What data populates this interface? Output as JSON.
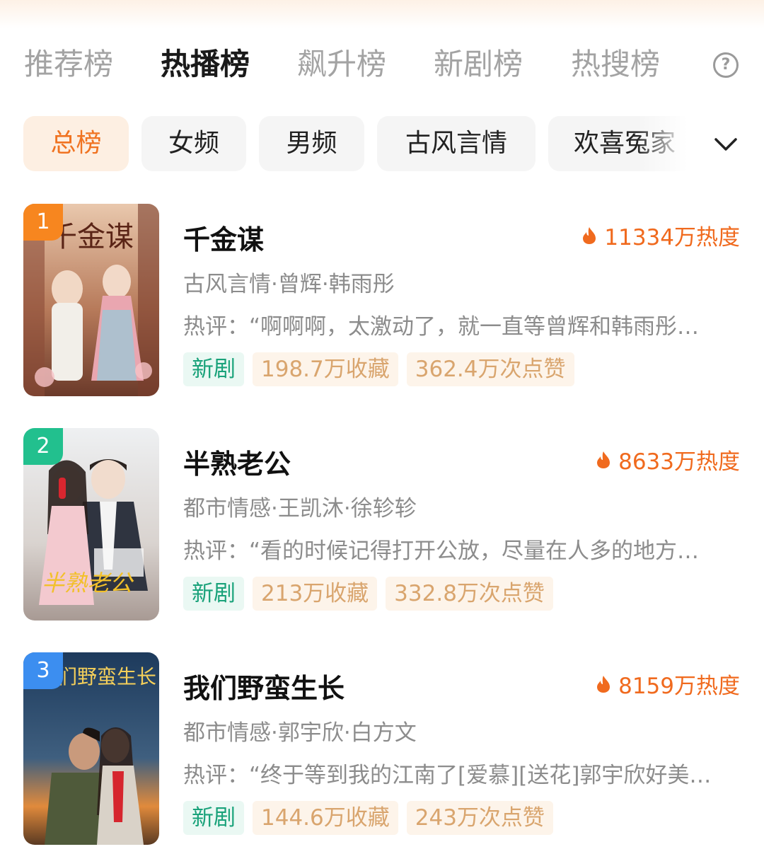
{
  "tabs": [
    {
      "label": "推荐榜",
      "active": false
    },
    {
      "label": "热播榜",
      "active": true
    },
    {
      "label": "飙升榜",
      "active": false
    },
    {
      "label": "新剧榜",
      "active": false
    },
    {
      "label": "热搜榜",
      "active": false
    }
  ],
  "help_icon": {
    "glyph": "?",
    "icon": "question-circle-icon"
  },
  "filters": [
    {
      "label": "总榜",
      "active": true
    },
    {
      "label": "女频",
      "active": false
    },
    {
      "label": "男频",
      "active": false
    },
    {
      "label": "古风言情",
      "active": false
    },
    {
      "label": "欢喜冤家",
      "active": false
    }
  ],
  "expand_icon": "chevron-down-icon",
  "colors": {
    "accent": "#f06a1e",
    "rank_1": "#f7861f",
    "rank_2": "#22c08e",
    "rank_3": "#3c8ef0",
    "tag_new_text": "#19a27a",
    "tag_stat_text": "#d9a56e"
  },
  "items": [
    {
      "rank": "1",
      "title": "千金谋",
      "heat": "11334万热度",
      "meta": "古风言情·曾辉·韩雨彤",
      "comment": "热评：“啊啊啊，太激动了，就一直等曾辉和韩雨彤…",
      "tags": {
        "new": "新剧",
        "collect": "198.7万收藏",
        "likes": "362.4万次点赞"
      },
      "poster_text": "千金谋"
    },
    {
      "rank": "2",
      "title": "半熟老公",
      "heat": "8633万热度",
      "meta": "都市情感·王凯沐·徐轸轸",
      "comment": "热评：“看的时候记得打开公放，尽量在人多的地方…",
      "tags": {
        "new": "新剧",
        "collect": "213万收藏",
        "likes": "332.8万次点赞"
      },
      "poster_text": "半熟老公"
    },
    {
      "rank": "3",
      "title": "我们野蛮生长",
      "heat": "8159万热度",
      "meta": "都市情感·郭宇欣·白方文",
      "comment": "热评：“终于等到我的江南了[爱慕][送花]郭宇欣好美…",
      "tags": {
        "new": "新剧",
        "collect": "144.6万收藏",
        "likes": "243万次点赞"
      },
      "poster_text": "我们野蛮生长"
    }
  ]
}
